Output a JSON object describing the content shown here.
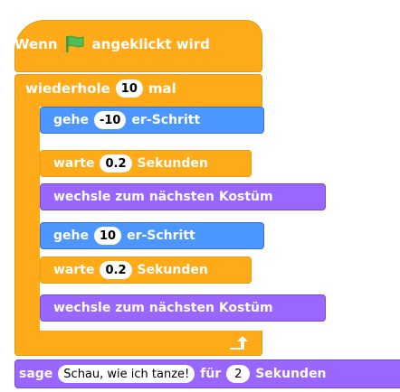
{
  "hat": {
    "part1": "Wenn",
    "part2": "angeklickt wird",
    "flag_icon": "green-flag-icon"
  },
  "repeat": {
    "label1": "wiederhole",
    "count": "10",
    "label2": "mal",
    "arrow_icon": "repeat-arrow-icon"
  },
  "inner_blocks": [
    {
      "type": "motion",
      "label1": "gehe",
      "value": "-10",
      "label2": "er-Schritt"
    },
    {
      "type": "control",
      "label1": "warte",
      "value": "0.2",
      "label2": "Sekunden"
    },
    {
      "type": "looks",
      "label1": "wechsle zum nächsten Kostüm"
    },
    {
      "type": "motion",
      "label1": "gehe",
      "value": "10",
      "label2": "er-Schritt"
    },
    {
      "type": "control",
      "label1": "warte",
      "value": "0.2",
      "label2": "Sekunden"
    },
    {
      "type": "looks",
      "label1": "wechsle zum nächsten Kostüm"
    }
  ],
  "say": {
    "label1": "sage",
    "text": "Schau, wie ich tanze!",
    "label2": "für",
    "seconds": "2",
    "label3": "Sekunden"
  },
  "colors": {
    "control": "#ffab19",
    "motion": "#4c97ff",
    "looks": "#9966ff"
  }
}
